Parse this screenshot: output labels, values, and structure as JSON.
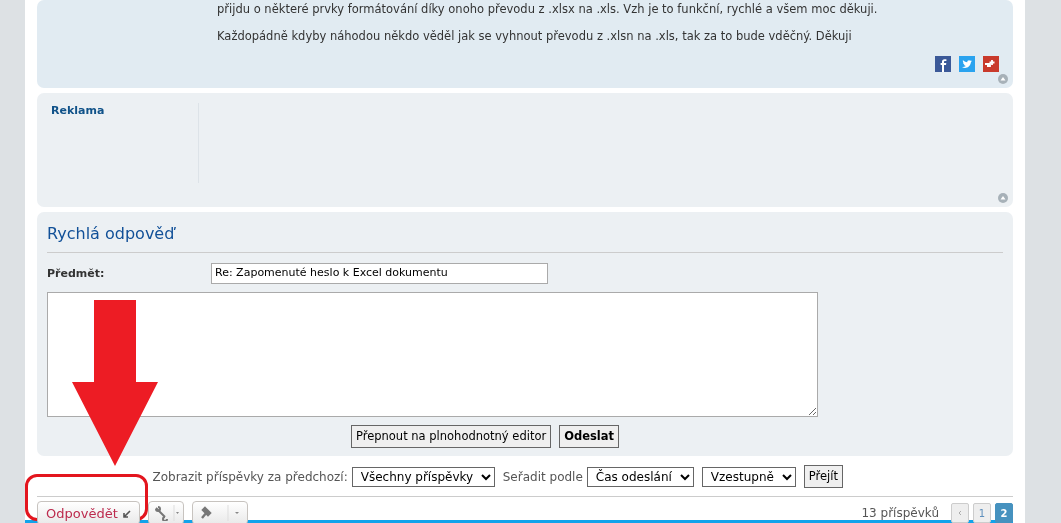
{
  "post": {
    "paragraphs": [
      "přijdu o některé prvky formátování díky onoho převodu z .xlsx na .xls. Vzh je to funkční, rychlé a všem moc děkuji.",
      "Každopádně kdyby náhodou někdo věděl jak se vyhnout převodu z .xlsn na .xls, tak za to bude vděčný. Děkuji"
    ]
  },
  "ad": {
    "label": "Reklama"
  },
  "quick_reply": {
    "title": "Rychlá odpověď",
    "subject_label": "Předmět:",
    "subject_value": "Re: Zapomenuté heslo k Excel dokumentu",
    "buttons": [
      {
        "label": "Přepnout na plnohodnotný editor",
        "kind": "normal"
      },
      {
        "label": "Odeslat",
        "kind": "primary"
      }
    ]
  },
  "sort_bar": {
    "display_label": "Zobrazit příspěvky za předchozí:",
    "display_value": "Všechny příspěvky",
    "sort_label": "Seřadit podle",
    "sort_value": "Čas odeslání",
    "order_value": "Vzestupně",
    "go_button": "Přejít"
  },
  "actions": {
    "reply_button": "Odpovědět"
  },
  "pagination": {
    "count": "13 příspěvků",
    "pages": [
      {
        "label": "1",
        "selected": false
      },
      {
        "label": "2",
        "selected": true
      }
    ]
  }
}
